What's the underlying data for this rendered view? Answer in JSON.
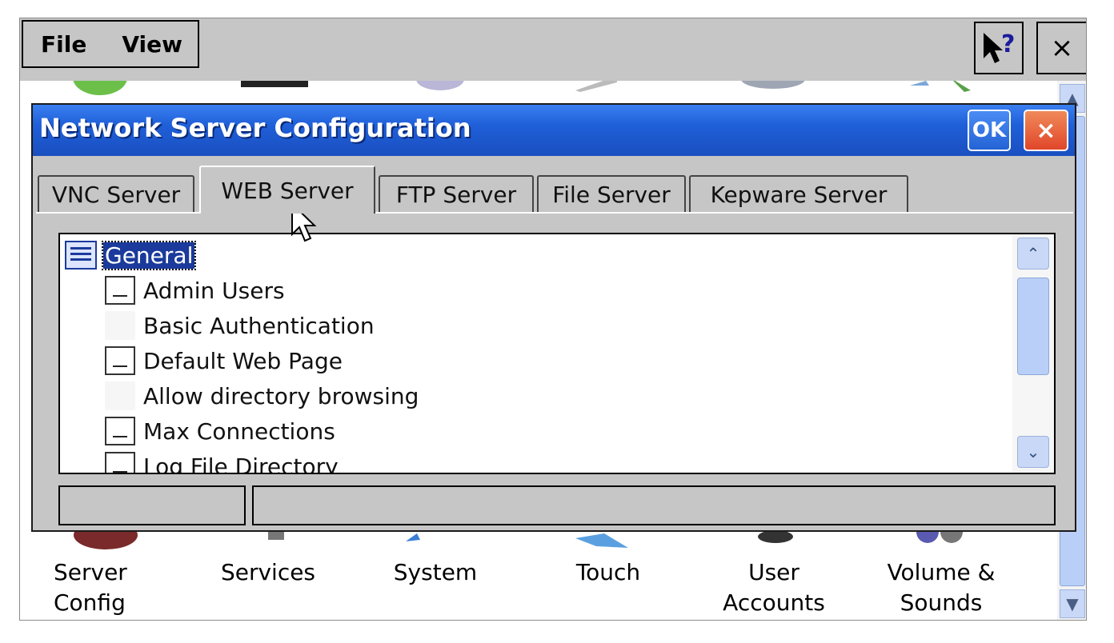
{
  "menubar": {
    "file_label": "File",
    "view_label": "View",
    "help_icon": "help-pointer-icon",
    "close_label": "×"
  },
  "dialog": {
    "title": "Network Server Configuration",
    "ok_label": "OK",
    "close_label": "×",
    "tabs": [
      {
        "label": "VNC Server"
      },
      {
        "label": "WEB Server"
      },
      {
        "label": "FTP Server"
      },
      {
        "label": "File Server"
      },
      {
        "label": "Kepware Server"
      }
    ],
    "active_tab": "WEB Server",
    "tree": {
      "root_label": "General",
      "items": [
        {
          "label": "Admin Users"
        },
        {
          "label": "Basic Authentication"
        },
        {
          "label": "Default Web Page"
        },
        {
          "label": "Allow directory browsing"
        },
        {
          "label": "Max Connections"
        },
        {
          "label": "Log File Directory"
        }
      ]
    }
  },
  "control_panel": {
    "items": [
      {
        "label": "Server\nConfig"
      },
      {
        "label": "Services"
      },
      {
        "label": "System"
      },
      {
        "label": "Touch"
      },
      {
        "label": "User\nAccounts"
      },
      {
        "label": "Volume &\nSounds"
      }
    ]
  },
  "colors": {
    "title_blue": "#1f5fd8",
    "selection": "#1b3a9c",
    "dialog_gray": "#c6c6c6",
    "scroll_blue": "#b9cff7"
  }
}
